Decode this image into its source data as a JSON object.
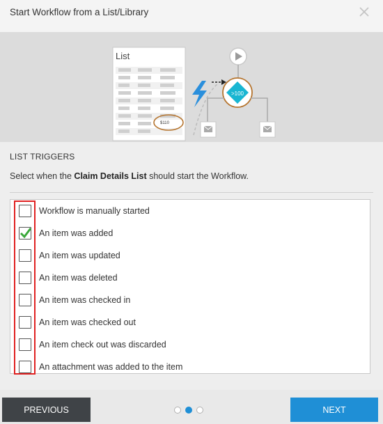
{
  "dialog": {
    "title": "Start Workflow from a List/Library"
  },
  "illustration": {
    "list_title": "List",
    "highlight_value": "$110",
    "condition_label": ">100"
  },
  "section": {
    "heading": "LIST TRIGGERS",
    "description_prefix": "Select when the ",
    "list_name": "Claim Details List",
    "description_suffix": " should start the Workflow."
  },
  "triggers": [
    {
      "label": "Workflow is manually started",
      "checked": false
    },
    {
      "label": "An item was added",
      "checked": true
    },
    {
      "label": "An item was updated",
      "checked": false
    },
    {
      "label": "An item was deleted",
      "checked": false
    },
    {
      "label": "An item was checked in",
      "checked": false
    },
    {
      "label": "An item was checked out",
      "checked": false
    },
    {
      "label": "An item check out was discarded",
      "checked": false
    },
    {
      "label": "An attachment was added to the item",
      "checked": false
    }
  ],
  "pagination": {
    "total": 3,
    "current": 1
  },
  "footer": {
    "previous_label": "PREVIOUS",
    "next_label": "NEXT"
  },
  "colors": {
    "accent": "#1f8fd6",
    "check": "#3aa83a",
    "highlight_border": "#e02020",
    "condition_diamond": "#19b6d2"
  }
}
